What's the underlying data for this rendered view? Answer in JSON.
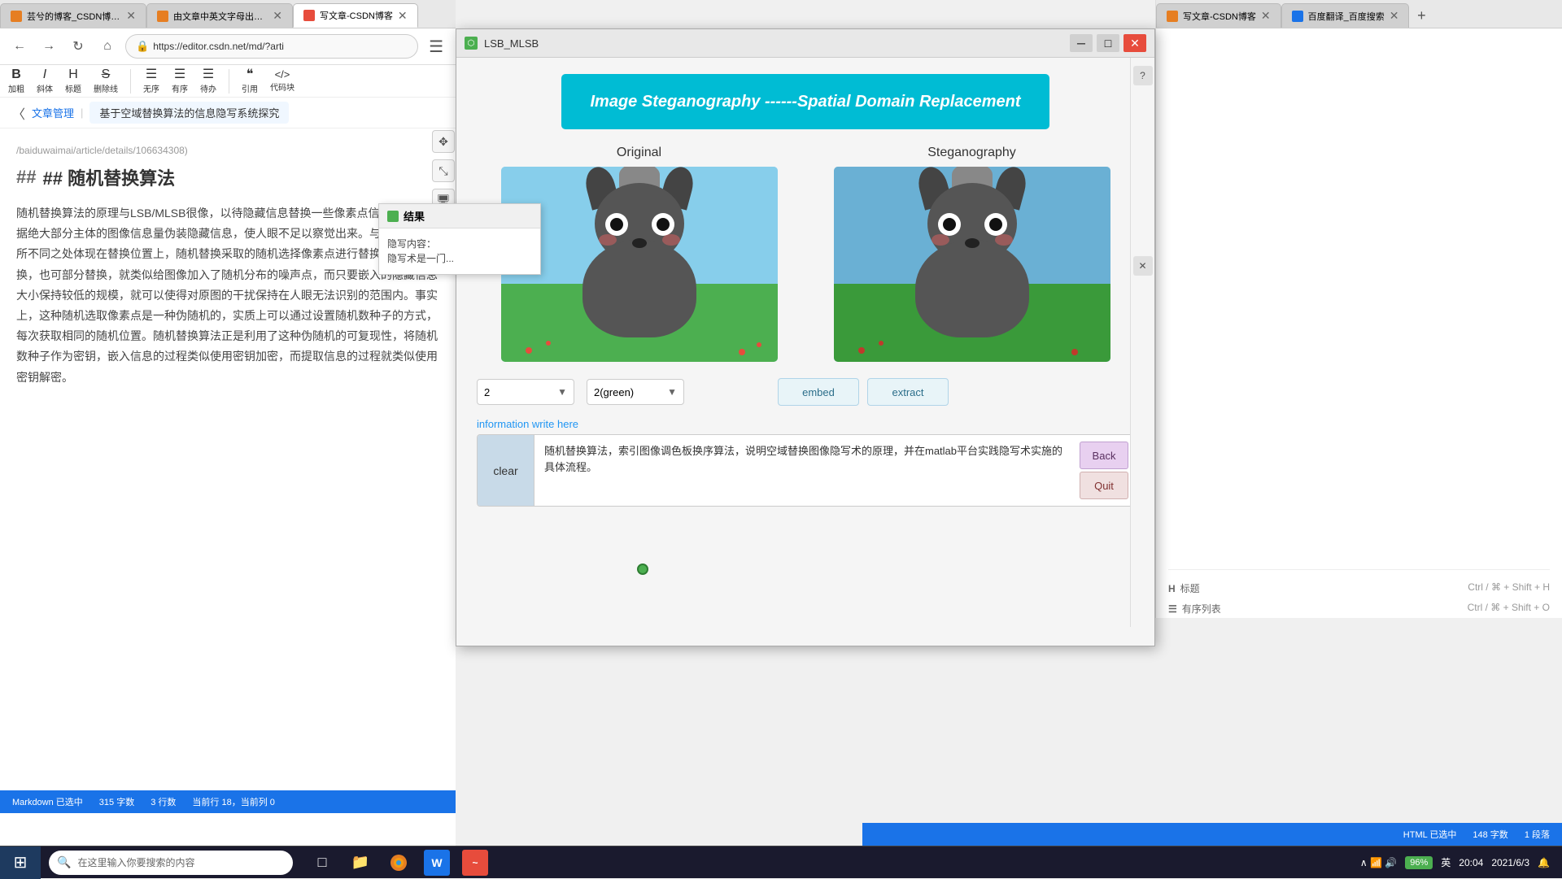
{
  "browser_left": {
    "tabs": [
      {
        "label": "芸兮的博客_CSDN博客-数字...",
        "icon_color": "orange",
        "active": false
      },
      {
        "label": "由文章中英文字母出现频率多...",
        "icon_color": "orange",
        "active": false
      },
      {
        "label": "写文章-CSDN博客",
        "icon_color": "red",
        "active": true
      },
      {
        "label": "写文章-CSDN博客",
        "icon_color": "orange",
        "active": false
      }
    ],
    "address": "https://editor.csdn.net/md/?arti",
    "toolbar": {
      "bold": "B",
      "bold_label": "加粗",
      "italic": "I",
      "italic_label": "斜体",
      "heading": "H",
      "heading_label": "标题",
      "strikethrough": "S",
      "strikethrough_label": "删除线",
      "unordered": "≡",
      "unordered_label": "无序",
      "ordered": "≡",
      "ordered_label": "有序",
      "todo": "≡",
      "todo_label": "待办",
      "quote": "❝",
      "quote_label": "引用",
      "code": "</>",
      "code_label": "代码块"
    },
    "breadcrumb": {
      "back": "〈",
      "nav": "文章管理",
      "title": "基于空域替换算法的信息隐写系统探究"
    },
    "content": {
      "url": "/baiduwaimai/article/details/106634308)",
      "heading": "## 随机替换算法",
      "body": "随机替换算法的原理与LSB/MLSB很像，以待隐藏信息替换一些像素点信息，借助占据绝大部分主体的图像信息量伪装隐藏信息，使人眼不足以察觉出来。与LSB/MLSB所不同之处体现在替换位置上，随机替换采取的随机选择像素点进行替换，可全部替换，也可部分替换，就类似给图像加入了随机分布的噪声点，而只要嵌入的隐藏信息大小保持较低的规模，就可以使得对原图的干扰保持在人眼无法识别的范围内。事实上，这种随机选取像素点是一种伪随机的，实质上可以通过设置随机数种子的方式，每次获取相同的随机位置。随机替换算法正是利用了这种伪随机的可复现性，将随机数种子作为密钥，嵌入信息的过程类似使用密钥加密，而提取信息的过程就类似使用密钥解密。"
    },
    "status": {
      "mode": "Markdown 已选中",
      "chars": "315 字数",
      "rows": "3 行数",
      "current": "当前行 18，当前列 0"
    }
  },
  "popup_window": {
    "title": "LSB_MLSB",
    "header": "Image Steganography ------Spatial Domain Replacement",
    "original_label": "Original",
    "steganography_label": "Steganography",
    "controls": {
      "select1_value": "2",
      "select2_value": "2(green)",
      "btn_embed": "embed",
      "btn_extract": "extract"
    },
    "text_area": {
      "label": "information write here",
      "clear_btn": "clear",
      "content": "随机替换算法，索引图像调色板换序算法，说明空域替换图像隐写术的原理，并在matlab平台实践隐写术实施的具体流程。"
    },
    "side_buttons": {
      "back": "Back",
      "quit": "Quit"
    }
  },
  "result_popup": {
    "title": "结果",
    "line1": "隐写内容：",
    "line2": "隐写术是一门..."
  },
  "browser_second": {
    "title": "写文章-CSDN博客",
    "hotkeys": [
      {
        "label": "标题",
        "icon": "H",
        "keys": "Ctrl / ⌘ + Shift + H"
      },
      {
        "label": "有序列表",
        "icon": "≡",
        "keys": "Ctrl / ⌘ + Shift + O"
      }
    ]
  },
  "taskbar": {
    "search_placeholder": "在这里输入你要搜索的内容",
    "time": "20:04",
    "date": "2021/6/3",
    "battery": "96%",
    "lang": "英",
    "icons": [
      "⊞",
      "🔍",
      "□",
      "📁",
      "🦊",
      "W",
      "~"
    ]
  }
}
